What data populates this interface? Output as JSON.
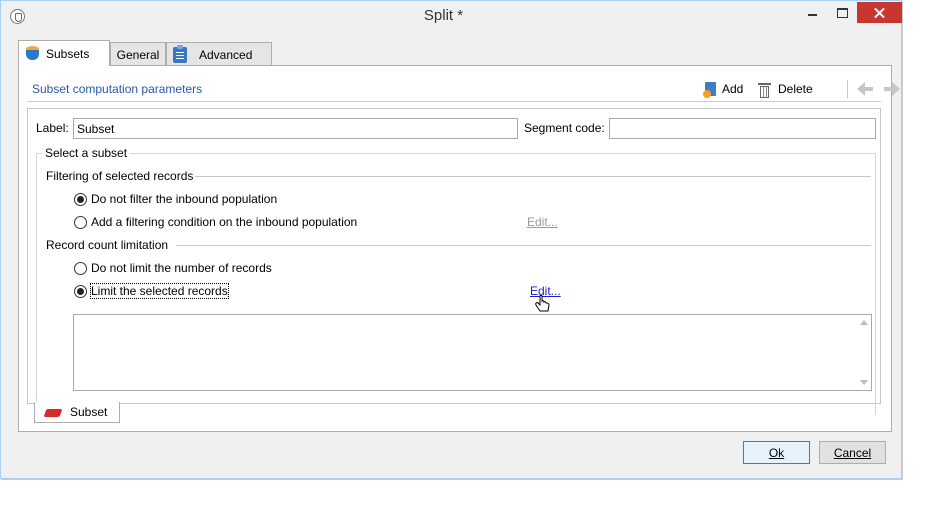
{
  "window": {
    "title": "Split *"
  },
  "tabs": [
    {
      "label": "Subsets",
      "icon": "database-icon"
    },
    {
      "label": "General"
    },
    {
      "label": "Advanced",
      "icon": "clipboard-icon"
    }
  ],
  "section": {
    "title": "Subset computation parameters",
    "add_label": "Add",
    "delete_label": "Delete"
  },
  "form": {
    "label_caption": "Label:",
    "label_value": "Subset",
    "segment_caption": "Segment code:",
    "segment_value": ""
  },
  "select_subset": {
    "legend": "Select a subset",
    "filtering": {
      "heading": "Filtering of selected records",
      "options": [
        {
          "label": "Do not filter the inbound population",
          "checked": true
        },
        {
          "label": "Add a filtering condition on the inbound population",
          "checked": false
        }
      ],
      "edit_label": "Edit..."
    },
    "limitation": {
      "heading": "Record count limitation",
      "options": [
        {
          "label": "Do not limit the number of records",
          "checked": false
        },
        {
          "label": "Limit the selected records",
          "checked": true
        }
      ],
      "edit_label": "Edit..."
    }
  },
  "subset_tab": {
    "label": "Subset"
  },
  "buttons": {
    "ok": "Ok",
    "cancel": "Cancel"
  },
  "colors": {
    "accent": "#2a5aa6",
    "close": "#c7372f",
    "link": "#1a22c8"
  }
}
